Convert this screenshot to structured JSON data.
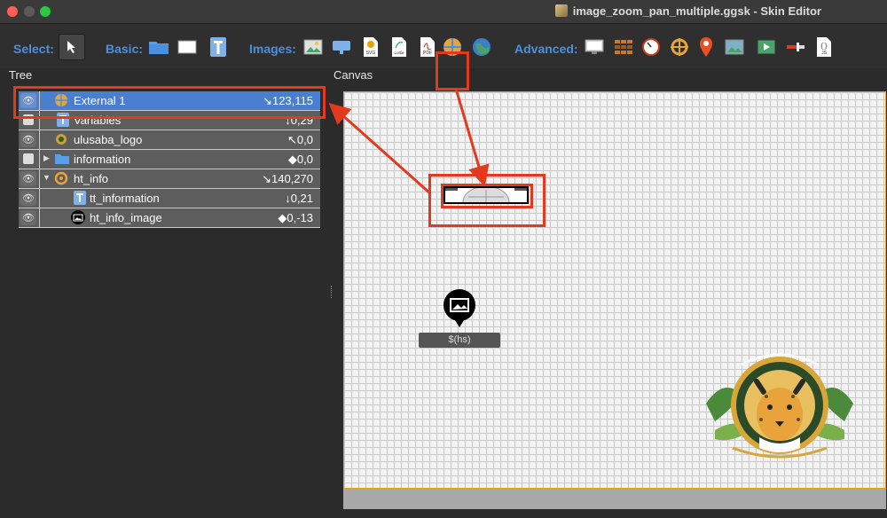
{
  "window": {
    "title": "image_zoom_pan_multiple.ggsk - Skin Editor"
  },
  "toolbar": {
    "select_label": "Select:",
    "basic_label": "Basic:",
    "images_label": "Images:",
    "advanced_label": "Advanced:",
    "svg_text": "SVG",
    "lottie_text": "Lottie",
    "pdf_text": "PDF",
    "js_text": "JS",
    "accent_color": "#4a90e2",
    "highlight_color": "#e33a1e"
  },
  "panels": {
    "tree_label": "Tree",
    "canvas_label": "Canvas"
  },
  "tree": {
    "items": [
      {
        "name": "External 1",
        "coord": "↘123,115",
        "icon": "external-icon",
        "selected": true
      },
      {
        "name": "Variables",
        "coord": "↓0,29",
        "icon": "text-icon"
      },
      {
        "name": "ulusaba_logo",
        "coord": "↖0,0",
        "icon": "logo-thumb-icon"
      },
      {
        "name": "information",
        "coord": "◆0,0",
        "icon": "folder-icon"
      },
      {
        "name": "ht_info",
        "coord": "↘140,270",
        "icon": "hotspot-icon"
      },
      {
        "name": "tt_information",
        "coord": "↓0,21",
        "icon": "text-icon"
      },
      {
        "name": "ht_info_image",
        "coord": "◆0,-13",
        "icon": "image-icon"
      }
    ]
  },
  "canvas": {
    "info_text": "$(hs)",
    "logo_image": "jaguar-logo"
  }
}
